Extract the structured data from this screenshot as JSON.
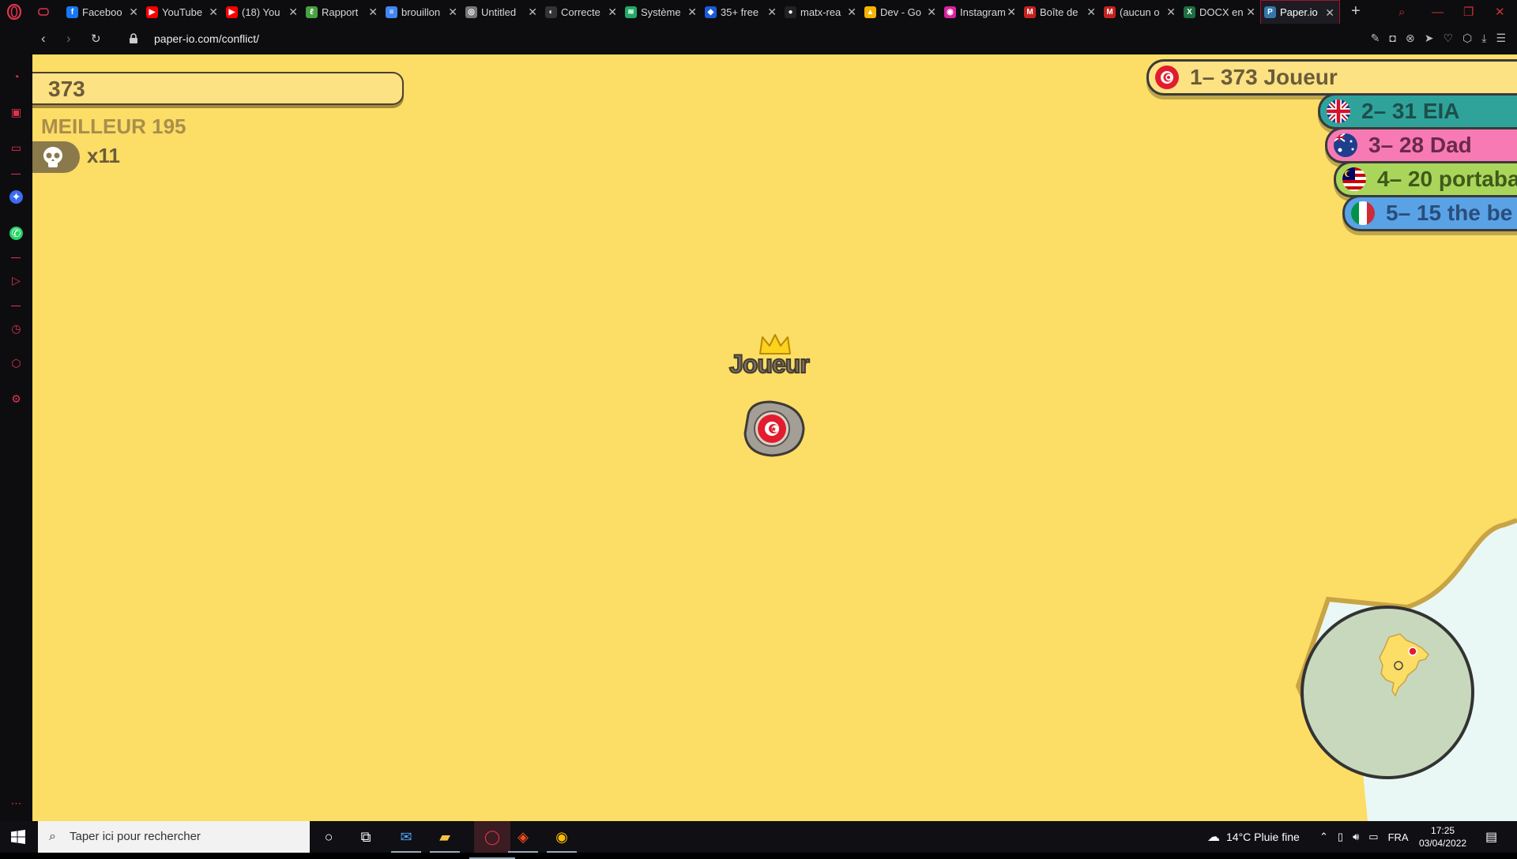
{
  "browser": {
    "tabs": [
      {
        "label": "Faceboo",
        "icon": "facebook-icon",
        "color": "#1877f2",
        "glyph": "f"
      },
      {
        "label": "YouTube",
        "icon": "youtube-icon",
        "color": "#ff0000",
        "glyph": "▶"
      },
      {
        "label": "(18) You",
        "icon": "youtube-icon",
        "color": "#ff0000",
        "glyph": "▶"
      },
      {
        "label": "Rapport",
        "icon": "overleaf-icon",
        "color": "#47a141",
        "glyph": "ℓ"
      },
      {
        "label": "brouillon",
        "icon": "google-docs-icon",
        "color": "#4285f4",
        "glyph": "≡"
      },
      {
        "label": "Untitled",
        "icon": "doc-icon",
        "color": "#777",
        "glyph": "◎"
      },
      {
        "label": "Correcte",
        "icon": "grammar-icon",
        "color": "#333",
        "glyph": "◐"
      },
      {
        "label": "Système",
        "icon": "system-icon",
        "color": "#2a6",
        "glyph": "≋"
      },
      {
        "label": "35+ free",
        "icon": "diamond-icon",
        "color": "#1a5bd8",
        "glyph": "◆"
      },
      {
        "label": "matx-rea",
        "icon": "github-icon",
        "color": "#222",
        "glyph": "●"
      },
      {
        "label": "Dev - Go",
        "icon": "google-drive-icon",
        "color": "#f4b400",
        "glyph": "▲"
      },
      {
        "label": "Instagram",
        "icon": "instagram-icon",
        "color": "#d6249f",
        "glyph": "◉"
      },
      {
        "label": "Boîte de",
        "icon": "gmail-icon",
        "color": "#c5221f",
        "glyph": "M"
      },
      {
        "label": "(aucun o",
        "icon": "gmail-icon",
        "color": "#c5221f",
        "glyph": "M"
      },
      {
        "label": "DOCX en",
        "icon": "excel-icon",
        "color": "#1d6f42",
        "glyph": "X"
      },
      {
        "label": "Paper.io",
        "icon": "paperio-icon",
        "color": "#37a",
        "glyph": "P",
        "active": true
      }
    ],
    "url": "paper-io.com/conflict/"
  },
  "game": {
    "score": "373",
    "best": "MEILLEUR 195",
    "kills": "x11",
    "player_name": "Joueur",
    "leaderboard": [
      {
        "text": "1– 373 Joueur",
        "bg": "#fde283",
        "fg": "#6b5c3a",
        "flag": "tunisia"
      },
      {
        "text": "2– 31 EIA",
        "bg": "#2fa39a",
        "fg": "#1d4f4c",
        "flag": "uk"
      },
      {
        "text": "3– 28 Dad",
        "bg": "#f77ab5",
        "fg": "#6a2a4a",
        "flag": "australia"
      },
      {
        "text": "4– 20 portaba",
        "bg": "#a9d65a",
        "fg": "#3f5a1b",
        "flag": "malaysia"
      },
      {
        "text": "5– 15 the be",
        "bg": "#5aa2e6",
        "fg": "#2a4d7a",
        "flag": "italy"
      }
    ],
    "colors": {
      "field": "#fcdd66",
      "outside": "#e9f8f4",
      "tunisia_red": "#e21c2e"
    }
  },
  "taskbar": {
    "search_placeholder": "Taper ici pour rechercher",
    "weather": "14°C  Pluie fine",
    "lang": "FRA",
    "time": "17:25",
    "date": "03/04/2022"
  }
}
